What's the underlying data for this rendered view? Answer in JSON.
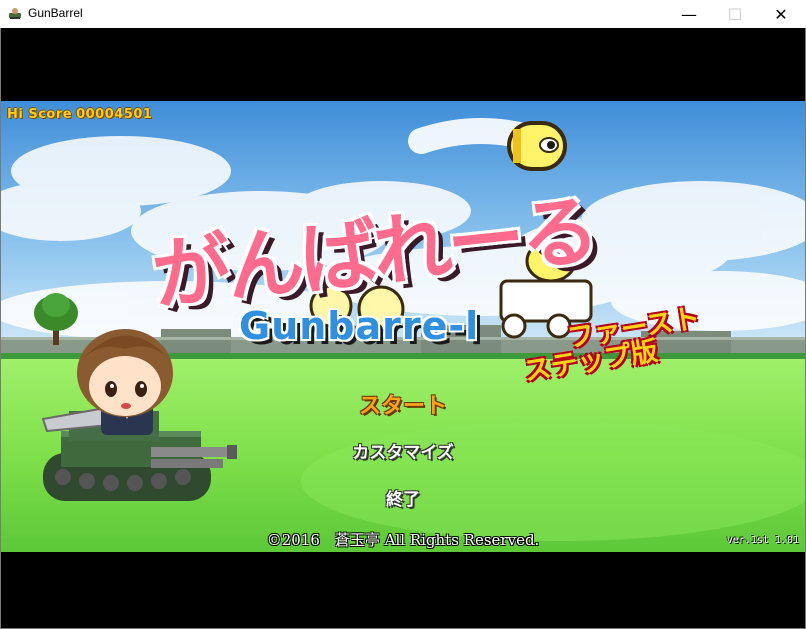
{
  "window": {
    "title": "GunBarrel",
    "min_glyph": "—",
    "max_glyph": "☐",
    "close_glyph": "✕"
  },
  "hud": {
    "hiscore_label": "Hi Score",
    "hiscore_value": "00004501"
  },
  "logo": {
    "title_jp": "がんばれーる",
    "title_en": "Gunbarre-l",
    "edition_line1": "ファースト",
    "edition_line2": "ステップ版"
  },
  "menu": {
    "start": "スタート",
    "customize": "カスタマイズ",
    "quit": "終了"
  },
  "footer": {
    "copyright": "©2016　蒼玉亭 All Rights Reserved.",
    "version": "ver.1st 1.01"
  },
  "colors": {
    "sky_top": "#3f8ed8",
    "grass": "#7fe04a",
    "menu_highlight": "#ffa21a",
    "hiscore": "#ffcc1a"
  }
}
